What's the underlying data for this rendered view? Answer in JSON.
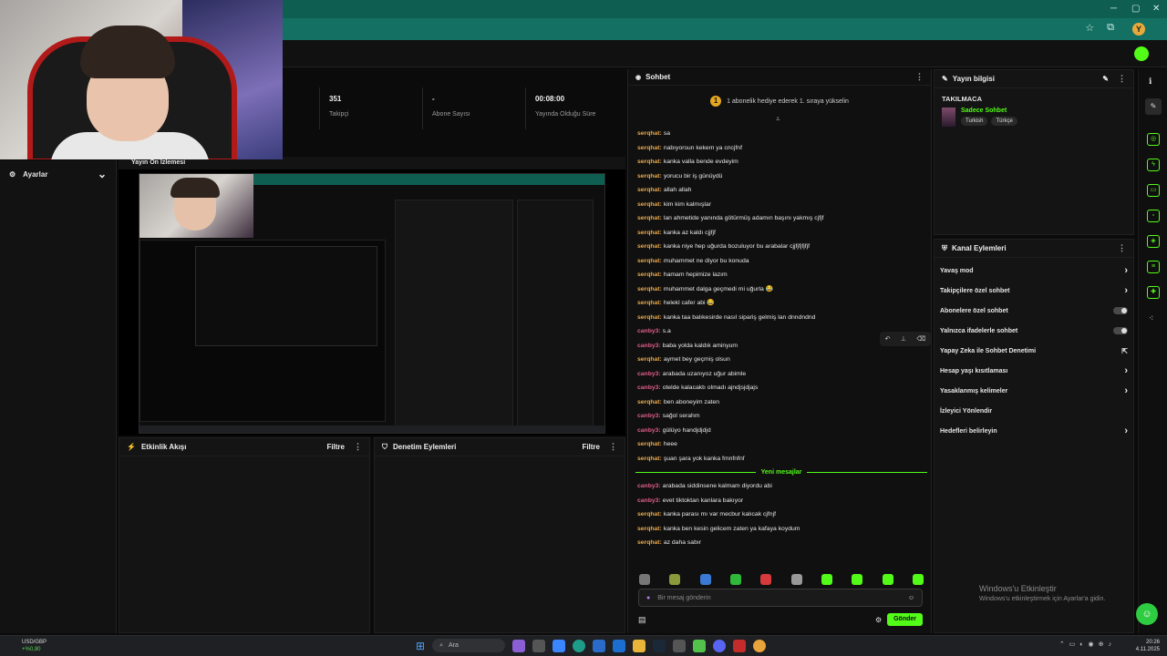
{
  "window": {
    "minimize": "─",
    "maximize": "▢",
    "close": "✕"
  },
  "profile_initial": "Y",
  "webcam_label": "Yayın Ön İzlemesi",
  "stats": [
    {
      "value": "351",
      "label": "Takipçi"
    },
    {
      "value": "-",
      "label": "Abone Sayısı"
    },
    {
      "value": "00:08:00",
      "label": "Yayında Olduğu Süre"
    }
  ],
  "sidebar": {
    "title": "Ayarlar"
  },
  "chat": {
    "title": "Sohbet",
    "gift_badge": "1",
    "gift_banner": "1 abonelik hediye ederek 1. sıraya yükselin",
    "messages": [
      {
        "user": "serqhat:",
        "text": "sa",
        "color": "#e8a84a"
      },
      {
        "user": "serqhat:",
        "text": "nabıyorsun kekem ya cncjfnf",
        "color": "#e8a84a"
      },
      {
        "user": "serqhat:",
        "text": "kanka valla bende evdeyim",
        "color": "#e8a84a"
      },
      {
        "user": "serqhat:",
        "text": "yorucu bir iş günüydü",
        "color": "#e8a84a"
      },
      {
        "user": "serqhat:",
        "text": "allah allah",
        "color": "#e8a84a"
      },
      {
        "user": "serqhat:",
        "text": "kim kim kalmışlar",
        "color": "#e8a84a"
      },
      {
        "user": "serqhat:",
        "text": "lan ahmetide yanında götürmüş adamın başını yakmış cjfjf",
        "color": "#e8a84a"
      },
      {
        "user": "serqhat:",
        "text": "kanka az kaldı cjjfjf",
        "color": "#e8a84a"
      },
      {
        "user": "serqhat:",
        "text": "kanka niye hep uğurda bozuluyor bu arabalar cjjfjfjfjfjf",
        "color": "#e8a84a"
      },
      {
        "user": "serqhat:",
        "text": "muhammet ne diyor bu konuda",
        "color": "#e8a84a"
      },
      {
        "user": "serqhat:",
        "text": "hamam hepimize lazım",
        "color": "#e8a84a"
      },
      {
        "user": "serqhat:",
        "text": "muhammet dalga geçmedi mi uğurla 😂",
        "color": "#e8a84a"
      },
      {
        "user": "serqhat:",
        "text": "helekl cafer abi 😂",
        "color": "#e8a84a"
      },
      {
        "user": "serqhat:",
        "text": "kanka taa balıkesirde nasıl sipariş gelmiş lan dnndndnd",
        "color": "#e8a84a"
      },
      {
        "user": "canby3:",
        "text": "s.a",
        "color": "#e05c8a"
      },
      {
        "user": "canby3:",
        "text": "baba yolda kaldık aminyum",
        "color": "#e05c8a"
      },
      {
        "user": "serqhat:",
        "text": "aymet bey geçmiş olsun",
        "color": "#e8a84a"
      },
      {
        "user": "canby3:",
        "text": "arabada uzanıyoz uğur abimle",
        "color": "#e05c8a"
      },
      {
        "user": "canby3:",
        "text": "otelde kalacaktı olmadı ajndjsjdjajs",
        "color": "#e05c8a"
      },
      {
        "user": "serqhat:",
        "text": "ben aboneyim zaten",
        "color": "#e8a84a"
      },
      {
        "user": "canby3:",
        "text": "sağol serahm",
        "color": "#e05c8a"
      },
      {
        "user": "canby3:",
        "text": "gülüyo handjdjdjd",
        "color": "#e05c8a"
      },
      {
        "user": "serqhat:",
        "text": "heee",
        "color": "#e8a84a"
      },
      {
        "user": "serqhat:",
        "text": "şuan şara yok kanka fmnfnfnf",
        "color": "#e8a84a"
      }
    ],
    "new_messages_label": "Yeni mesajlar",
    "new_messages": [
      {
        "user": "canby3:",
        "text": "arabada siddinsene kalmam diyordu abi",
        "color": "#e05c8a"
      },
      {
        "user": "canby3:",
        "text": "evet tiktoktan kanlara bakıyor",
        "color": "#e05c8a"
      },
      {
        "user": "serqhat:",
        "text": "kanka parası mı var mecbur kalıcak cjfnjf",
        "color": "#e8a84a"
      },
      {
        "user": "serqhat:",
        "text": "kanka ben kesin gelicem zaten ya kafaya koydum",
        "color": "#e8a84a"
      },
      {
        "user": "serqhat:",
        "text": "az daha sabır",
        "color": "#e8a84a"
      }
    ],
    "input_placeholder": "Bir mesaj gönderin",
    "send_label": "Gönder",
    "emote_colors": [
      "#777",
      "#8a9a3a",
      "#3a7ad6",
      "#2fb83a",
      "#d63a3a",
      "#999",
      "#53fc18",
      "#53fc18",
      "#53fc18",
      "#53fc18"
    ]
  },
  "info": {
    "title": "Yayın bilgisi",
    "stream_title": "TAKILMACA",
    "category": "Sadece Sohbet",
    "tags": [
      "Turkish",
      "Türkçe"
    ]
  },
  "actions": {
    "title": "Kanal Eylemleri",
    "items": [
      {
        "label": "Yavaş mod",
        "control": "chevron"
      },
      {
        "label": "Takipçilere özel sohbet",
        "control": "chevron"
      },
      {
        "label": "Abonelere özel sohbet",
        "control": "toggle"
      },
      {
        "label": "Yalnızca ifadelerle sohbet",
        "control": "toggle"
      },
      {
        "label": "Yapay Zeka ile Sohbet Denetimi",
        "control": "external"
      },
      {
        "label": "Hesap yaşı kısıtlaması",
        "control": "chevron"
      },
      {
        "label": "Yasaklanmış kelimeler",
        "control": "chevron"
      },
      {
        "label": "İzleyici Yönlendir",
        "control": "none"
      },
      {
        "label": "Hedefleri belirleyin",
        "control": "chevron"
      }
    ]
  },
  "feed": {
    "title": "Etkinlik Akışı",
    "filter": "Filtre"
  },
  "moderation": {
    "title": "Denetim Eylemleri",
    "filter": "Filtre"
  },
  "watermark": {
    "title": "Windows'u Etkinleştir",
    "subtitle": "Windows'u etkinleştirmek için Ayarlar'a gidin."
  },
  "taskbar": {
    "ticker": "USD/GBP",
    "ticker_change": "+%0,80",
    "search": "Ara",
    "time": "20:26",
    "date": "4.11.2025"
  },
  "icons": {
    "gear": "⚙",
    "chevron_down": "⌄",
    "chevron_right": "›",
    "chat": "💬",
    "edit": "✎",
    "more": "⋮",
    "info": "ℹ",
    "external": "⇱",
    "mic": "🎤",
    "smile": "☺",
    "help": "☺",
    "windows": "⊞",
    "search": "⌕",
    "undo": "↶",
    "pin": "📌",
    "trash": "🗑"
  }
}
